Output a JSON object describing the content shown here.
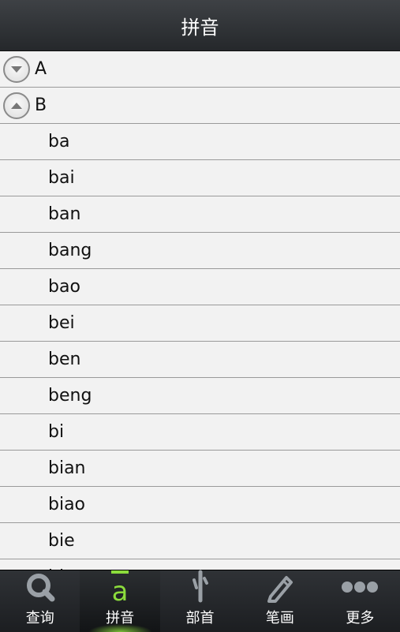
{
  "header": {
    "title": "拼音"
  },
  "groups": [
    {
      "letter": "A",
      "state": "collapsed"
    },
    {
      "letter": "B",
      "state": "expanded"
    }
  ],
  "b_items": [
    "ba",
    "bai",
    "ban",
    "bang",
    "bao",
    "bei",
    "ben",
    "beng",
    "bi",
    "bian",
    "biao",
    "bie",
    "bin"
  ],
  "tabs": [
    {
      "label": "查询",
      "icon": "search-icon",
      "active": false
    },
    {
      "label": "拼音",
      "icon": "pinyin-a-macron-icon",
      "active": true
    },
    {
      "label": "部首",
      "icon": "radical-icon",
      "active": false
    },
    {
      "label": "笔画",
      "icon": "pencil-icon",
      "active": false
    },
    {
      "label": "更多",
      "icon": "more-dots-icon",
      "active": false
    }
  ],
  "colors": {
    "accent": "#8cdc3c",
    "header_bg": "#2f3236",
    "list_bg": "#f2f2f2"
  }
}
